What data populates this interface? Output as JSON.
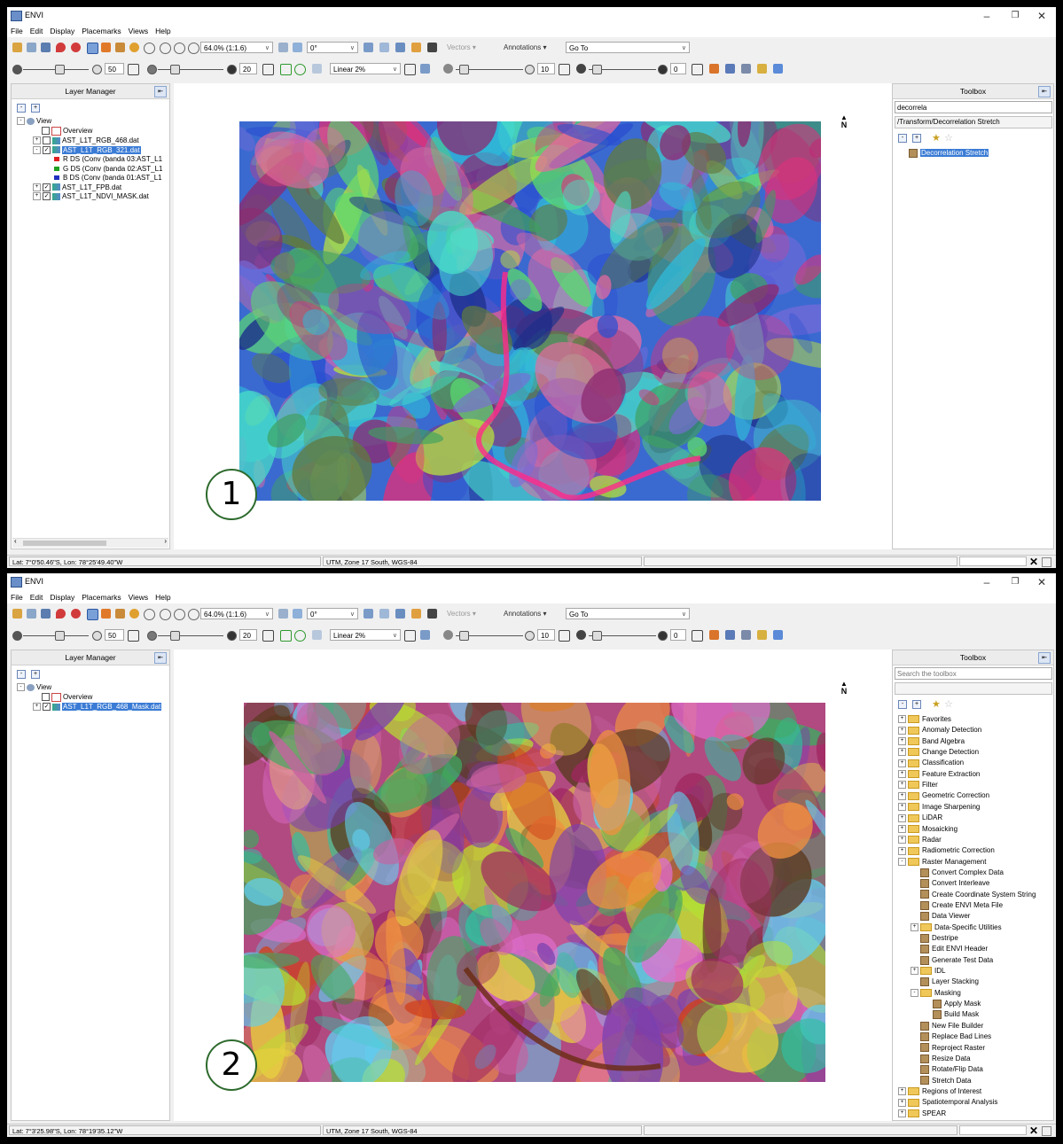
{
  "window": {
    "title": "ENVI",
    "minimize": "–",
    "restore": "❐",
    "close": "✕"
  },
  "menu": [
    "File",
    "Edit",
    "Display",
    "Placemarks",
    "Views",
    "Help"
  ],
  "toolbar": {
    "zoom_value": "64.0% (1:1.6)",
    "rotation_value": "0°",
    "vectors_label": "Vectors ▾",
    "annotations_label": "Annotations ▾",
    "goto_value": "Go To",
    "brightness_value": "50",
    "contrast_value": "20",
    "stretch_value": "Linear 2%",
    "sharpen_value": "10",
    "transparency_value": "0"
  },
  "screens": [
    {
      "number": "1",
      "layer_manager": {
        "title": "Layer Manager",
        "view_label": "View",
        "overview_label": "Overview",
        "layers": [
          {
            "label": "AST_L1T_RGB_468.dat",
            "checked": false,
            "selected": false
          },
          {
            "label": "AST_L1T_RGB_321.dat",
            "checked": true,
            "selected": true
          },
          {
            "label": "R DS (Conv (banda 03:AST_L1",
            "band": "red"
          },
          {
            "label": "G DS (Conv (banda 02:AST_L1",
            "band": "green"
          },
          {
            "label": "B DS (Conv (banda 01:AST_L1",
            "band": "blue"
          },
          {
            "label": "AST_L1T_FPB.dat",
            "checked": true,
            "selected": false
          },
          {
            "label": "AST_L1T_NDVI_MASK.dat",
            "checked": true,
            "selected": false
          }
        ]
      },
      "toolbox": {
        "title": "Toolbox",
        "search_value": "decorrela",
        "path_value": "/Transform/Decorrelation Stretch",
        "items": [
          {
            "label": "Decorrelation Stretch",
            "type": "tool",
            "selected": true
          }
        ]
      },
      "status": {
        "coords": "Lat: 7°0'50.46\"S, Lon: 78°25'49.40\"W",
        "projection": "UTM, Zone 17 South, WGS-84"
      },
      "north_label": "N"
    },
    {
      "number": "2",
      "layer_manager": {
        "title": "Layer Manager",
        "view_label": "View",
        "overview_label": "Overview",
        "layers": [
          {
            "label": "AST_L1T_RGB_468_Mask.dat",
            "checked": true,
            "selected": true
          }
        ]
      },
      "toolbox": {
        "title": "Toolbox",
        "search_placeholder": "Search the toolbox",
        "path_value": "",
        "items": [
          {
            "label": "Favorites",
            "type": "folder",
            "level": 0
          },
          {
            "label": "Anomaly Detection",
            "type": "folder",
            "level": 0
          },
          {
            "label": "Band Algebra",
            "type": "folder",
            "level": 0
          },
          {
            "label": "Change Detection",
            "type": "folder",
            "level": 0
          },
          {
            "label": "Classification",
            "type": "folder",
            "level": 0
          },
          {
            "label": "Feature Extraction",
            "type": "folder",
            "level": 0
          },
          {
            "label": "Filter",
            "type": "folder",
            "level": 0
          },
          {
            "label": "Geometric Correction",
            "type": "folder",
            "level": 0
          },
          {
            "label": "Image Sharpening",
            "type": "folder",
            "level": 0
          },
          {
            "label": "LiDAR",
            "type": "folder",
            "level": 0
          },
          {
            "label": "Mosaicking",
            "type": "folder",
            "level": 0
          },
          {
            "label": "Radar",
            "type": "folder",
            "level": 0
          },
          {
            "label": "Radiometric Correction",
            "type": "folder",
            "level": 0
          },
          {
            "label": "Raster Management",
            "type": "folder",
            "level": 0,
            "expanded": true
          },
          {
            "label": "Convert Complex Data",
            "type": "tool",
            "level": 1
          },
          {
            "label": "Convert Interleave",
            "type": "tool",
            "level": 1
          },
          {
            "label": "Create Coordinate System String",
            "type": "tool",
            "level": 1
          },
          {
            "label": "Create ENVI Meta File",
            "type": "tool",
            "level": 1
          },
          {
            "label": "Data Viewer",
            "type": "tool",
            "level": 1
          },
          {
            "label": "Data-Specific Utilities",
            "type": "folder",
            "level": 1
          },
          {
            "label": "Destripe",
            "type": "tool",
            "level": 1
          },
          {
            "label": "Edit ENVI Header",
            "type": "tool",
            "level": 1
          },
          {
            "label": "Generate Test Data",
            "type": "tool",
            "level": 1
          },
          {
            "label": "IDL",
            "type": "folder",
            "level": 1
          },
          {
            "label": "Layer Stacking",
            "type": "tool",
            "level": 1
          },
          {
            "label": "Masking",
            "type": "folder",
            "level": 1,
            "expanded": true
          },
          {
            "label": "Apply Mask",
            "type": "tool",
            "level": 2
          },
          {
            "label": "Build Mask",
            "type": "tool",
            "level": 2
          },
          {
            "label": "New File Builder",
            "type": "tool",
            "level": 1
          },
          {
            "label": "Replace Bad Lines",
            "type": "tool",
            "level": 1
          },
          {
            "label": "Reproject Raster",
            "type": "tool",
            "level": 1
          },
          {
            "label": "Resize Data",
            "type": "tool",
            "level": 1
          },
          {
            "label": "Rotate/Flip Data",
            "type": "tool",
            "level": 1
          },
          {
            "label": "Stretch Data",
            "type": "tool",
            "level": 1
          },
          {
            "label": "Regions of Interest",
            "type": "folder",
            "level": 0
          },
          {
            "label": "Spatiotemporal Analysis",
            "type": "folder",
            "level": 0
          },
          {
            "label": "SPEAR",
            "type": "folder",
            "level": 0
          }
        ]
      },
      "status": {
        "coords": "Lat: 7°3'25.98\"S, Lon: 78°19'35.12\"W",
        "projection": "UTM, Zone 17 South, WGS-84"
      },
      "north_label": "N"
    }
  ]
}
